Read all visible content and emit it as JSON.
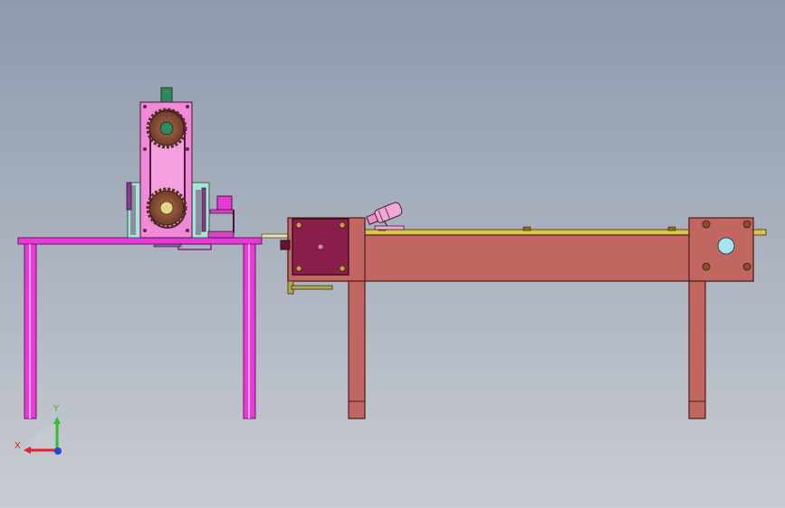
{
  "viewport": {
    "background_top": "#8d9aad",
    "background_bottom": "#c9ccd2"
  },
  "triad": {
    "x_label": "X",
    "y_label": "Y",
    "x_color": "#e0232a",
    "y_color": "#2fbf2f",
    "z_color": "#2646d9"
  },
  "colors": {
    "left_table": "#e83ad6",
    "gearbox": "#f08ad8",
    "gear": "#8a4e38",
    "motor": "#8a1e4a",
    "frame": "#c26662",
    "rail": "#d8c448"
  }
}
